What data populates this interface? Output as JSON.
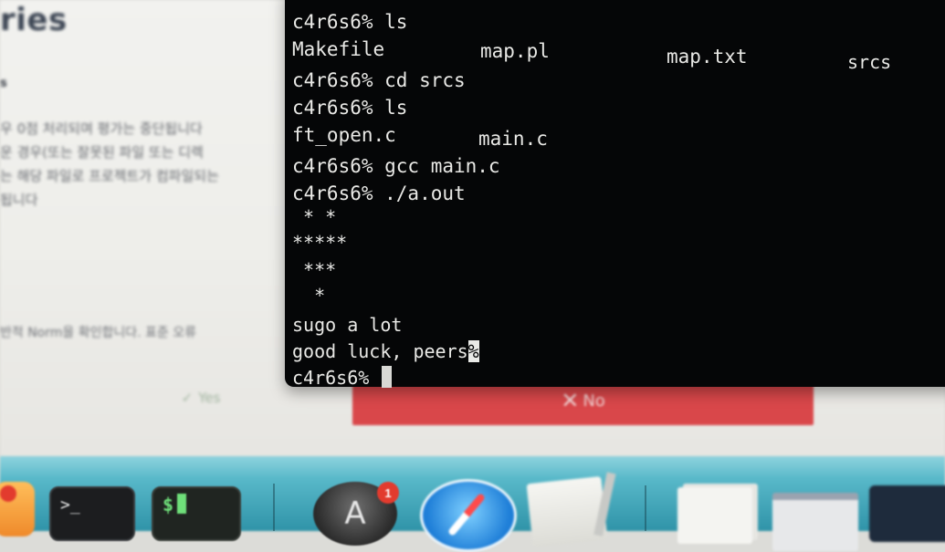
{
  "background_page": {
    "title": "ries",
    "subheading": "s",
    "paragraph_lines": [
      "우 0점 처리되며 평가는 중단됩니다",
      "운 경우(또는 잘못된 파일 또는 디렉",
      "는 해당 파일로 프로젝트가 컴파일되는",
      "됩니다"
    ],
    "question": "반적 Norm을 확인합니다. 표준 오류",
    "yes_label": "Yes",
    "no_label": "No",
    "no_color": "#d9474a"
  },
  "terminal": {
    "prompt": "c4r6s6%",
    "lines": [
      {
        "type": "command",
        "text": "c4r6s6% ls"
      },
      {
        "type": "listing",
        "items": [
          "Makefile",
          "map.pl",
          "map.txt",
          "srcs"
        ]
      },
      {
        "type": "command",
        "text": "c4r6s6% cd srcs"
      },
      {
        "type": "command",
        "text": "c4r6s6% ls"
      },
      {
        "type": "listing",
        "items": [
          "ft_open.c",
          "main.c"
        ]
      },
      {
        "type": "command",
        "text": "c4r6s6% gcc main.c"
      },
      {
        "type": "command",
        "text": "c4r6s6% ./a.out"
      },
      {
        "type": "output",
        "text": " * *"
      },
      {
        "type": "output",
        "text": "*****"
      },
      {
        "type": "output",
        "text": " ***"
      },
      {
        "type": "output",
        "text": "  *"
      },
      {
        "type": "output",
        "text": "sugo a lot"
      },
      {
        "type": "output",
        "text": "good luck, peers",
        "highlight": "%"
      },
      {
        "type": "command",
        "text": "c4r6s6% "
      }
    ]
  },
  "dock": {
    "items": [
      {
        "name": "app-left",
        "icon": "app-icon",
        "badge": ""
      },
      {
        "name": "terminal",
        "icon": "terminal-icon",
        "glyph": ">_"
      },
      {
        "name": "console",
        "icon": "console-icon",
        "glyph": "$"
      },
      {
        "name": "app-store",
        "icon": "app-store-icon",
        "badge": "1"
      },
      {
        "name": "safari",
        "icon": "safari-icon"
      },
      {
        "name": "textedit",
        "icon": "textedit-icon"
      },
      {
        "name": "documents",
        "icon": "documents-icon"
      },
      {
        "name": "window",
        "icon": "window-icon"
      },
      {
        "name": "folder",
        "icon": "folder-icon"
      }
    ]
  }
}
